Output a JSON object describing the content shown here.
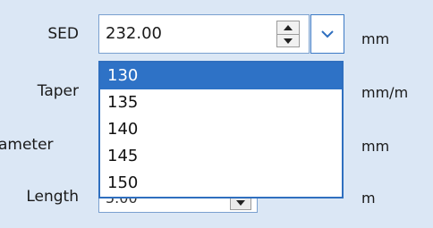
{
  "labels": {
    "sed": "SED",
    "taper": "Taper",
    "diameter": "ameter",
    "length": "Length"
  },
  "units": {
    "sed": "mm",
    "taper": "mm/m",
    "diameter": "mm",
    "length": "m"
  },
  "sed_field": {
    "value": "232.00"
  },
  "length_field": {
    "value": "5.00"
  },
  "dropdown": {
    "options": [
      "130",
      "135",
      "140",
      "145",
      "150"
    ],
    "selected_index": 0
  },
  "icons": {
    "spinner_up": "triangle-up-icon",
    "spinner_down": "triangle-down-icon",
    "dropdown": "chevron-down-icon"
  }
}
